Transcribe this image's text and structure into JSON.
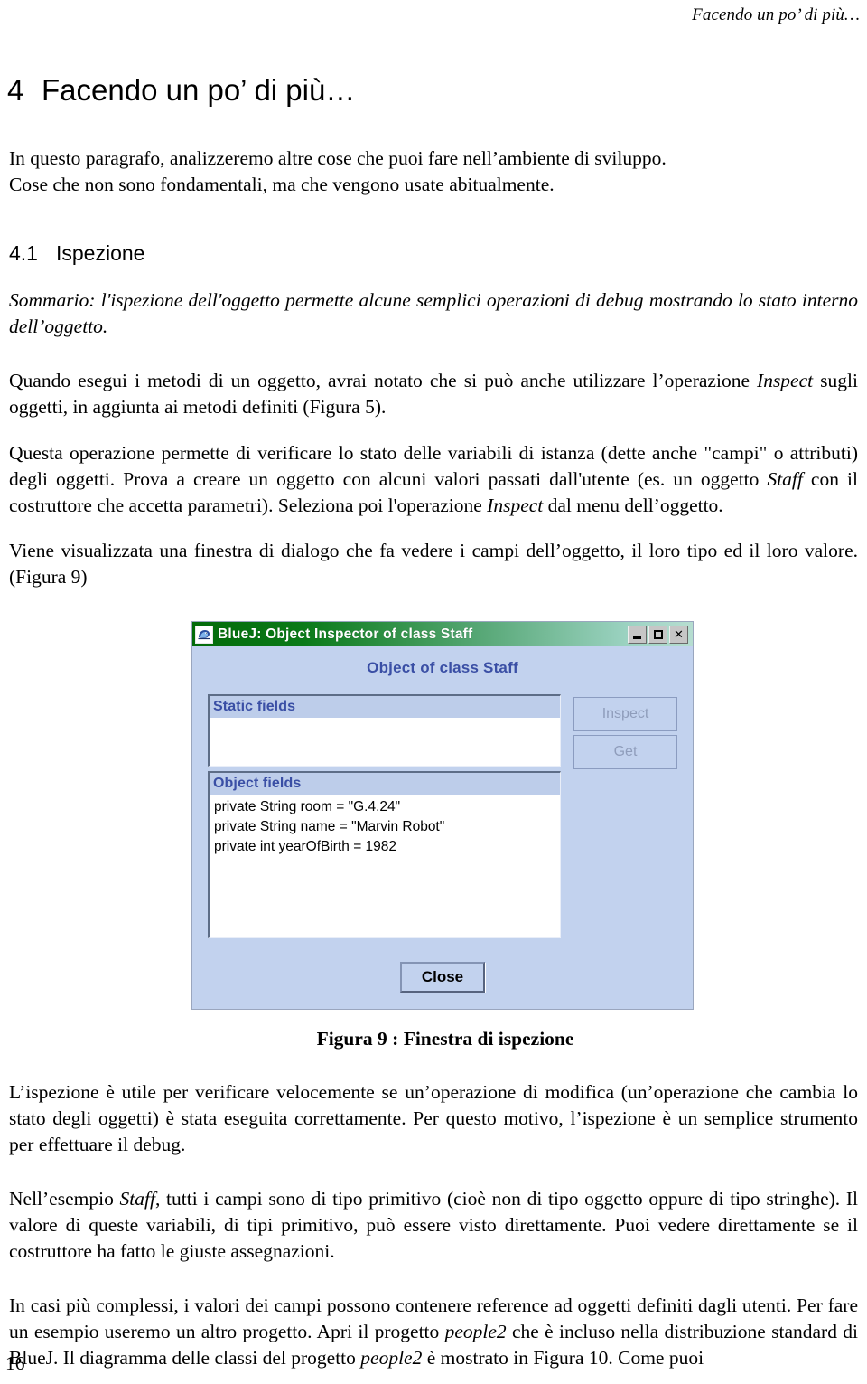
{
  "header": {
    "running_head": "Facendo un po’ di più…"
  },
  "chapter": {
    "number": "4",
    "title": "Facendo un po’ di più…"
  },
  "intro": {
    "line1": "In questo paragrafo, analizzeremo altre cose che puoi fare nell’ambiente di sviluppo.",
    "line2": "Cose che non sono fondamentali, ma che vengono usate abitualmente."
  },
  "section": {
    "number": "4.1",
    "title": "Ispezione",
    "summary": "Sommario: l'ispezione dell'oggetto permette alcune semplici operazioni di debug mostrando lo stato interno dell’oggetto."
  },
  "paragraphs": {
    "p1_a": "Quando esegui i metodi di un oggetto, avrai notato che si può anche utilizzare l’operazione ",
    "p1_em1": "Inspect",
    "p1_b": " sugli oggetti, in aggiunta ai metodi definiti (Figura 5).",
    "p2_a": "Questa operazione permette di verificare lo stato delle variabili di istanza (dette anche \"campi\" o attributi) degli oggetti. Prova a creare un oggetto con alcuni valori passati dall'utente (es. un oggetto ",
    "p2_em1": "Staff",
    "p2_b": " con il costruttore che accetta parametri). Seleziona poi l'operazione ",
    "p2_em2": "Inspect",
    "p2_c": " dal menu dell’oggetto.",
    "p3": "Viene visualizzata una finestra di dialogo che fa vedere i campi dell’oggetto, il loro tipo ed il loro valore.(Figura 9)",
    "p4": "L’ispezione è utile per verificare velocemente se un’operazione di modifica (un’operazione che cambia lo stato degli oggetti) è stata eseguita correttamente. Per questo motivo, l’ispezione è un semplice strumento per effettuare il debug.",
    "p5_a": "Nell’esempio ",
    "p5_em1": "Staff",
    "p5_b": ", tutti i campi sono di tipo primitivo (cioè non di tipo oggetto oppure di tipo stringhe). Il valore di queste variabili, di tipi primitivo, può essere visto direttamente. Puoi vedere direttamente se il costruttore ha fatto le giuste assegnazioni.",
    "p6_a": "In casi più complessi, i valori dei campi possono contenere reference ad oggetti definiti dagli utenti. Per fare un esempio useremo un altro progetto. Apri il progetto ",
    "p6_em1": "people2",
    "p6_b": " che è incluso nella distribuzione standard di BlueJ. Il diagramma delle classi del progetto ",
    "p6_em2": "people2",
    "p6_c": " è mostrato in Figura 10. Come puoi"
  },
  "figure": {
    "caption": "Figura 9 : Finestra di ispezione",
    "dialog": {
      "icon_name": "bluej-logo-icon",
      "titlebar_text": "BlueJ:  Object Inspector of class Staff",
      "window_buttons": {
        "minimize": "minimize-icon",
        "maximize": "maximize-icon",
        "close": "✕"
      },
      "object_title": "Object of class Staff",
      "static_fields": {
        "header": "Static fields",
        "rows": []
      },
      "object_fields": {
        "header": "Object fields",
        "rows": [
          "private String room = \"G.4.24\"",
          "private String name = \"Marvin Robot\"",
          "private int yearOfBirth = 1982"
        ]
      },
      "side_buttons": {
        "inspect": "Inspect",
        "get": "Get"
      },
      "close_button": "Close",
      "colors": {
        "dialog_bg": "#c2d2ee",
        "title_text": "#3a4fa5",
        "titlebar_start": "#036b0a",
        "titlebar_end": "#b6ddd0",
        "disabled_text": "#8f9dbb"
      }
    }
  },
  "footer": {
    "page_number": "16"
  }
}
